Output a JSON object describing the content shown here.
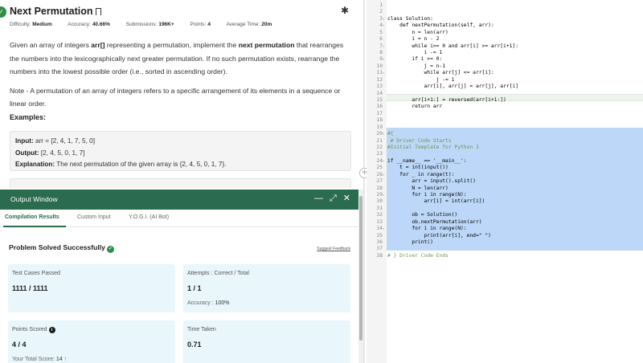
{
  "problem": {
    "title": "Next Permutation",
    "meta": [
      {
        "key": "Difficulty:",
        "value": "Medium"
      },
      {
        "key": "Accuracy:",
        "value": "40.66%"
      },
      {
        "key": "Submissions:",
        "value": "196K+"
      },
      {
        "key": "Points:",
        "value": "4"
      },
      {
        "key": "Average Time:",
        "value": "20m"
      }
    ],
    "desc_p1_a": "Given an array of integers ",
    "desc_p1_b": "arr[]",
    "desc_p1_c": " representing a permutation, implement the ",
    "desc_p1_d": "next permutation",
    "desc_p1_e": " that rearranges the numbers into the lexicographically next greater permutation. If no such permutation exists, rearrange the numbers into the lowest possible order (i.e., sorted in ascending order).",
    "note": "Note - A permutation of an array of integers refers to a specific arrangement of its elements in a sequence or linear order.",
    "examples_heading": "Examples:",
    "example": {
      "input_label": "Input:",
      "input_value": " arr = [2, 4, 1, 7, 5, 0]",
      "output_label": "Output:",
      "output_value": " [2, 4, 5, 0, 1, 7]",
      "explanation_label": "Explanation:",
      "explanation_value": " The next permutation of the given array is {2, 4, 5, 0, 1, 7}."
    }
  },
  "output_window": {
    "title": "Output Window",
    "tabs": [
      "Compilation Results",
      "Custom Input",
      "Y.O.G.I. (AI Bot)"
    ],
    "status": "Problem Solved Successfully",
    "suggest_feedback": "Suggest Feedback",
    "cards": {
      "tests_label": "Test Cases Passed",
      "tests_value": "1111 / 1111",
      "attempts_label": "Attempts : Correct / Total",
      "attempts_value": "1 / 1",
      "accuracy_label": "Accuracy : ",
      "accuracy_value": "100%",
      "points_label": "Points Scored",
      "points_value": "4 / 4",
      "total_score_label": "Your Total Score: ",
      "total_score_value": "14",
      "time_label": "Time Taken",
      "time_value": "0.71"
    }
  },
  "icons": {
    "solved": "✓",
    "bug": "✱",
    "minimize": "—",
    "expand": "⤢",
    "close": "✕",
    "info": "i",
    "up": "↑",
    "drag": "‹|›"
  },
  "editor": {
    "lines": [
      {
        "n": "1",
        "fold": "",
        "text": ""
      },
      {
        "n": "2",
        "fold": "",
        "text": ""
      },
      {
        "n": "3",
        "fold": "▾",
        "text": "class Solution:"
      },
      {
        "n": "4",
        "fold": "▾",
        "text": "    def nextPermutation(self, arr):"
      },
      {
        "n": "5",
        "fold": "",
        "text": "        n = len(arr)"
      },
      {
        "n": "6",
        "fold": "",
        "text": "        i = n - 2"
      },
      {
        "n": "7",
        "fold": "▾",
        "text": "        while i>= 0 and arr[i] >= arr[i+1]:"
      },
      {
        "n": "8",
        "fold": "",
        "text": "            i -= 1"
      },
      {
        "n": "9",
        "fold": "▾",
        "text": "        if i >= 0:"
      },
      {
        "n": "10",
        "fold": "",
        "text": "            j = n-1"
      },
      {
        "n": "11",
        "fold": "▾",
        "text": "            while arr[j] <= arr[i]:"
      },
      {
        "n": "12",
        "fold": "",
        "text": "                j -= 1"
      },
      {
        "n": "13",
        "fold": "",
        "text": "            arr[i], arr[j] = arr[j], arr[i]"
      },
      {
        "n": "14",
        "fold": "",
        "text": ""
      },
      {
        "n": "15",
        "fold": "",
        "text": "        arr[i+1:] = reversed(arr[i+1:])"
      },
      {
        "n": "16",
        "fold": "",
        "text": "        return arr"
      },
      {
        "n": "17",
        "fold": "",
        "text": ""
      },
      {
        "n": "18",
        "fold": "",
        "text": ""
      },
      {
        "n": "19",
        "fold": "",
        "text": ""
      },
      {
        "n": "20",
        "fold": "▾",
        "text": "#{"
      },
      {
        "n": "21",
        "fold": "",
        "text": " # Driver Code Starts"
      },
      {
        "n": "22",
        "fold": "",
        "text": "#Initial Template for Python 3"
      },
      {
        "n": "23",
        "fold": "",
        "text": ""
      },
      {
        "n": "24",
        "fold": "▾",
        "text": "if __name__ == '__main__':"
      },
      {
        "n": "25",
        "fold": "",
        "text": "    t = int(input())"
      },
      {
        "n": "26",
        "fold": "▾",
        "text": "    for _ in range(t):"
      },
      {
        "n": "27",
        "fold": "",
        "text": "        arr = input().split()"
      },
      {
        "n": "28",
        "fold": "",
        "text": "        N = len(arr)"
      },
      {
        "n": "29",
        "fold": "▾",
        "text": "        for i in range(N):"
      },
      {
        "n": "30",
        "fold": "",
        "text": "            arr[i] = int(arr[i])"
      },
      {
        "n": "31",
        "fold": "",
        "text": ""
      },
      {
        "n": "32",
        "fold": "",
        "text": "        ob = Solution()"
      },
      {
        "n": "33",
        "fold": "",
        "text": "        ob.nextPermutation(arr)"
      },
      {
        "n": "34",
        "fold": "▾",
        "text": "        for i in range(N):"
      },
      {
        "n": "35",
        "fold": "",
        "text": "            print(arr[i], end=\" \")"
      },
      {
        "n": "36",
        "fold": "",
        "text": "        print()"
      },
      {
        "n": "37",
        "fold": "",
        "text": ""
      },
      {
        "n": "38",
        "fold": "",
        "text": "# } Driver Code Ends"
      }
    ]
  },
  "colors": {
    "brand_green": "#2f8d46",
    "output_bar": "#2b6b4e",
    "card_bg": "#e9f6fb",
    "selection": "#bcd7f7"
  }
}
